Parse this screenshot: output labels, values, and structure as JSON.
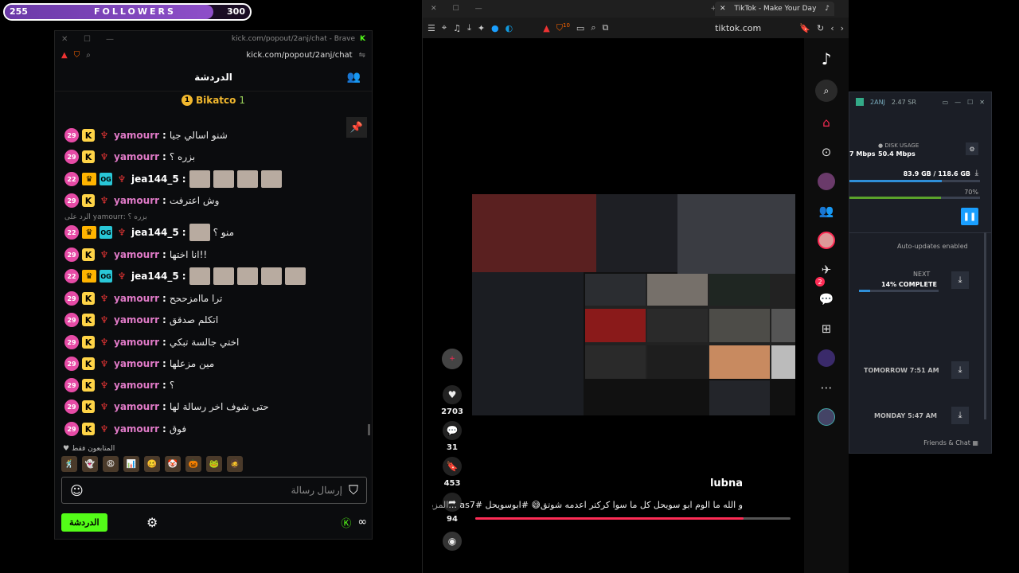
{
  "follower_goal": {
    "current": "255",
    "label": "FOLLOWERS",
    "target": "300",
    "progress": 0.85
  },
  "kick": {
    "title_url": "kick.com/popout/2anj/chat - Brave",
    "url": "kick.com/popout/2anj/chat",
    "header": "الدردشة",
    "pinned_user": "Bikatco",
    "pinned_count": "1",
    "pinned_rank": "1",
    "reply_to": "الرد على yamourr: بزره ؟",
    "messages": [
      {
        "level": "29",
        "user": "yamourr",
        "text": "شنو اسالي جيا",
        "emotes": 0,
        "sub": "k"
      },
      {
        "level": "29",
        "user": "yamourr",
        "text": "بزره ؟",
        "emotes": 0,
        "sub": "k"
      },
      {
        "level": "22",
        "user": "jea144_5",
        "text": "",
        "emotes": 4,
        "sub": "crown"
      },
      {
        "level": "29",
        "user": "yamourr",
        "text": "وش اعترفت",
        "emotes": 0,
        "sub": "k"
      },
      {
        "level": "22",
        "user": "jea144_5",
        "text": "منو ؟",
        "emotes": 1,
        "sub": "crown"
      },
      {
        "level": "29",
        "user": "yamourr",
        "text": "انا اختها!!",
        "emotes": 0,
        "sub": "k"
      },
      {
        "level": "22",
        "user": "jea144_5",
        "text": "",
        "emotes": 5,
        "sub": "crown"
      },
      {
        "level": "29",
        "user": "yamourr",
        "text": "ترا ماامزححح",
        "emotes": 0,
        "sub": "k"
      },
      {
        "level": "29",
        "user": "yamourr",
        "text": "اتكلم صدقق",
        "emotes": 0,
        "sub": "k"
      },
      {
        "level": "29",
        "user": "yamourr",
        "text": "اختي جالسة تبكي",
        "emotes": 0,
        "sub": "k"
      },
      {
        "level": "29",
        "user": "yamourr",
        "text": "مين مزعلها",
        "emotes": 0,
        "sub": "k"
      },
      {
        "level": "29",
        "user": "yamourr",
        "text": "؟",
        "emotes": 0,
        "sub": "k"
      },
      {
        "level": "29",
        "user": "yamourr",
        "text": "حتى شوف اخر رسالة لها",
        "emotes": 0,
        "sub": "k"
      },
      {
        "level": "29",
        "user": "yamourr",
        "text": "فوق",
        "emotes": 0,
        "sub": "k"
      }
    ],
    "followers_only": "المتابعون فقط",
    "input_placeholder": "إرسال رسالة",
    "send_label": "الدردشة"
  },
  "browser": {
    "tab_title": "TikTok - Make Your Day",
    "url": "tiktok.com",
    "shield_count": "10"
  },
  "tiktok": {
    "likes": "2703",
    "comments": "31",
    "saves": "453",
    "shares": "94",
    "author": "lubna",
    "description": "و الله ما الوم ابو سويحل كل ما سوا كركتر اعدمه شوتق😅 #ابوسويحل #as7 ...",
    "more_label": "المزيد",
    "inbox_badge": "2",
    "video_progress": 0.85
  },
  "steam": {
    "title": "2ANJ",
    "wallet": "2.47 SR",
    "net_speed": "7 Mbps",
    "disk_label": "DISK USAGE",
    "disk_speed": "50.4 Mbps",
    "size_progress": "83.9 GB / 118.6 GB",
    "size_ratio": 0.71,
    "percent": "70%",
    "percent_value": 0.7,
    "auto_updates": "Auto-updates enabled",
    "next_label": "NEXT",
    "next_progress": "14% COMPLETE",
    "next_ratio": 0.14,
    "sched1": "TOMORROW 7:51 AM",
    "sched2": "MONDAY 5:47 AM",
    "friends": "Friends & Chat"
  },
  "colors": {
    "kick_green": "#53fc18",
    "tiktok_red": "#fe2c55",
    "steam_blue": "#1a9fff",
    "pink_name": "#e07ac7"
  }
}
